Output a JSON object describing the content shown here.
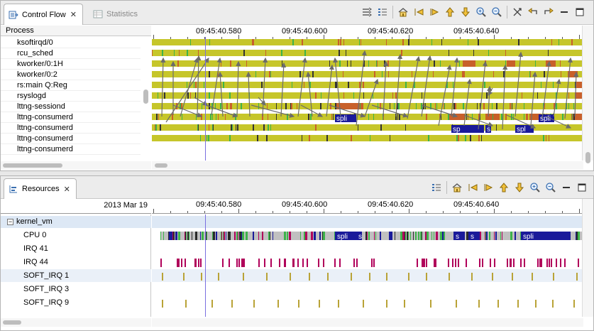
{
  "top_view": {
    "tabs": [
      {
        "label": "Control Flow",
        "icon": "control-flow-icon",
        "active": true
      },
      {
        "label": "Statistics",
        "icon": "statistics-icon",
        "active": false
      }
    ],
    "column_header": "Process",
    "time_labels": [
      "09:45:40.580",
      "09:45:40.600",
      "09:45:40.620",
      "09:45:40.640"
    ],
    "processes": [
      "ksoftirqd/0",
      "rcu_sched",
      "kworker/0:1H",
      "kworker/0:2",
      "rs:main Q:Reg",
      "rsyslogd",
      "lttng-sessiond",
      "lttng-consumerd",
      "lttng-consumerd",
      "lttng-consumerd",
      "lttng-consumerd"
    ],
    "state_labels": [
      "spli",
      "s",
      "sp",
      "spl",
      "spli"
    ],
    "toolbar_icons": [
      "filter-icon",
      "legend-icon",
      "home-icon",
      "previous-event-icon",
      "next-event-icon",
      "previous-item-icon",
      "next-item-icon",
      "zoom-in-icon",
      "zoom-out-icon",
      "hide-arrows-icon",
      "follow-arrow-back-icon",
      "follow-arrow-forward-icon",
      "minimize-icon",
      "maximize-icon"
    ]
  },
  "bottom_view": {
    "tabs": [
      {
        "label": "Resources",
        "icon": "resources-icon",
        "active": true
      }
    ],
    "date_label": "2013 Mar 19",
    "time_labels": [
      "09:45:40.580",
      "09:45:40.600",
      "09:45:40.620",
      "09:45:40.640"
    ],
    "tree_root": "kernel_vm",
    "resources": [
      "CPU 0",
      "IRQ 41",
      "IRQ 44",
      "SOFT_IRQ 1",
      "SOFT_IRQ 3",
      "SOFT_IRQ 9"
    ],
    "state_labels": [
      "spli",
      "s",
      "s",
      "s",
      "spli"
    ],
    "toolbar_icons": [
      "legend-icon",
      "home-icon",
      "previous-event-icon",
      "next-event-icon",
      "previous-item-icon",
      "next-item-icon",
      "zoom-in-icon",
      "zoom-out-icon",
      "minimize-icon",
      "maximize-icon"
    ]
  },
  "colors": {
    "running": "#c6c62a",
    "user": "#3db34a",
    "wait_blocked": "#c8602a",
    "syscall": "#1a1a9a",
    "irq": "#b0005a",
    "softirq": "#b9a337",
    "cpu_idle": "#c0c0c0",
    "selection_row": "#dde8f5",
    "arrow": "#6b6b6b",
    "cursor": "#7a6fe0"
  }
}
